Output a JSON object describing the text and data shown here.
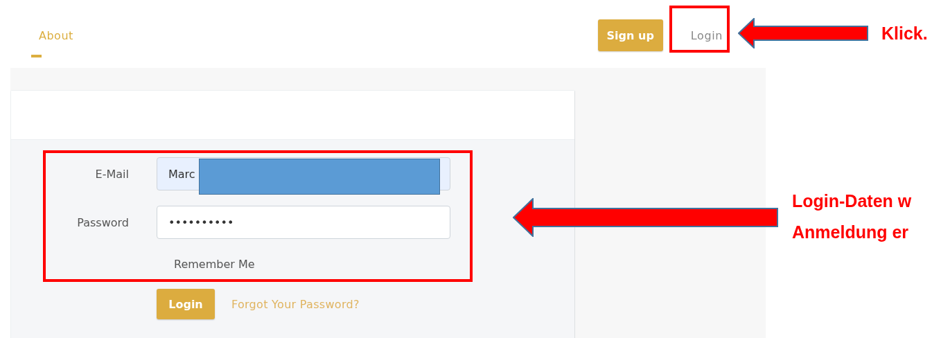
{
  "nav": {
    "links": [
      {
        "label": "About",
        "selected": true
      }
    ],
    "signup": "Sign up",
    "login": "Login"
  },
  "form": {
    "email_label": "E-Mail",
    "email_value": "Marc",
    "password_label": "Password",
    "password_value": "••••••••••",
    "remember": "Remember Me",
    "submit": "Login",
    "forgot": "Forgot Your Password?"
  },
  "annotations": [
    {
      "kind": "top",
      "text": [
        "Klick."
      ]
    },
    {
      "kind": "form",
      "text": [
        "Login-Daten w",
        "Anmeldung er"
      ]
    }
  ]
}
